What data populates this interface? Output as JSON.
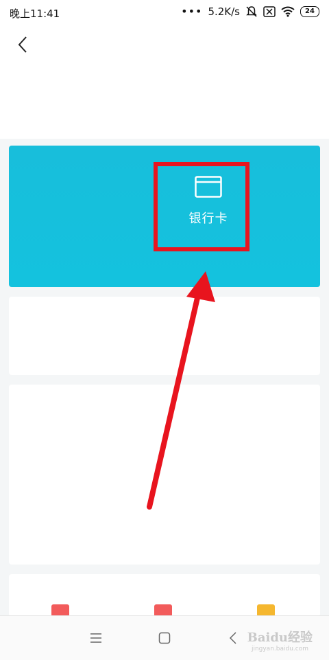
{
  "status_bar": {
    "time": "晚上11:41",
    "dots": "•••",
    "network_speed": "5.2K/s",
    "battery_level": "24"
  },
  "bank_card_panel": {
    "bank_card_label": "银行卡"
  },
  "watermark": {
    "brand": "Baidu经验",
    "url": "jingyan.baidu.com"
  },
  "colors": {
    "panel_bg": "#18bedb",
    "highlight": "#e8141e",
    "arrow": "#e8141e"
  },
  "icons": {
    "back": "back-chevron-icon",
    "bank_card": "bank-card-icon",
    "silent": "bell-off-icon",
    "sim": "sim-blocked-icon",
    "wifi": "wifi-icon"
  }
}
